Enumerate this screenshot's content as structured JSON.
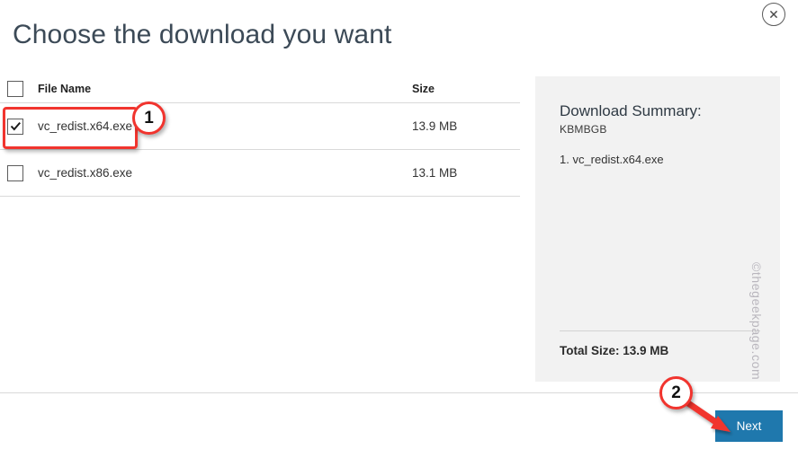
{
  "window": {
    "close_icon": "close-circle-icon"
  },
  "header": {
    "title": "Choose the download you want"
  },
  "table": {
    "columns": {
      "name": "File Name",
      "size": "Size"
    },
    "header_checkbox_checked": false,
    "rows": [
      {
        "name": "vc_redist.x64.exe",
        "size": "13.9 MB",
        "checked": true
      },
      {
        "name": "vc_redist.x86.exe",
        "size": "13.1 MB",
        "checked": false
      }
    ]
  },
  "summary": {
    "title": "Download Summary:",
    "subtitle": "KBMBGB",
    "items": [
      "1. vc_redist.x64.exe"
    ],
    "total_label": "Total Size: 13.9 MB"
  },
  "footer": {
    "next_label": "Next"
  },
  "watermark": {
    "text": "©thegeekpage.com"
  },
  "annotations": {
    "color": "#f1342e",
    "badge_one": "1",
    "badge_two": "2"
  }
}
